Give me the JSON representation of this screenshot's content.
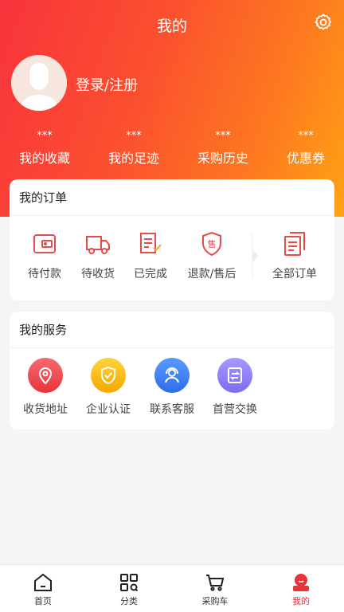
{
  "header": {
    "title": "我的"
  },
  "profile": {
    "login_label": "登录/注册"
  },
  "stats": [
    {
      "value": "***",
      "label": "我的收藏"
    },
    {
      "value": "***",
      "label": "我的足迹"
    },
    {
      "value": "***",
      "label": "采购历史"
    },
    {
      "value": "***",
      "label": "优惠券"
    }
  ],
  "orders": {
    "title": "我的订单",
    "items": [
      {
        "label": "待付款",
        "icon": "wallet-icon"
      },
      {
        "label": "待收货",
        "icon": "truck-icon"
      },
      {
        "label": "已完成",
        "icon": "completed-icon"
      },
      {
        "label": "退款/售后",
        "icon": "refund-shield-icon"
      },
      {
        "label": "全部订单",
        "icon": "all-orders-icon"
      }
    ]
  },
  "services": {
    "title": "我的服务",
    "items": [
      {
        "label": "收货地址",
        "icon": "location-icon",
        "color": "#f0464d"
      },
      {
        "label": "企业认证",
        "icon": "shield-check-icon",
        "color": "#f7b500"
      },
      {
        "label": "联系客服",
        "icon": "customer-service-icon",
        "color": "#3b7cf0"
      },
      {
        "label": "首营交换",
        "icon": "exchange-doc-icon",
        "color": "#8b7ff0"
      }
    ]
  },
  "tabbar": {
    "items": [
      {
        "label": "首页",
        "icon": "home-icon"
      },
      {
        "label": "分类",
        "icon": "category-icon"
      },
      {
        "label": "采购车",
        "icon": "cart-icon"
      },
      {
        "label": "我的",
        "icon": "profile-icon"
      }
    ],
    "active_index": 3
  },
  "colors": {
    "accent": "#e8333a",
    "gradient_start": "#f8333c",
    "gradient_end": "#ffa314"
  }
}
